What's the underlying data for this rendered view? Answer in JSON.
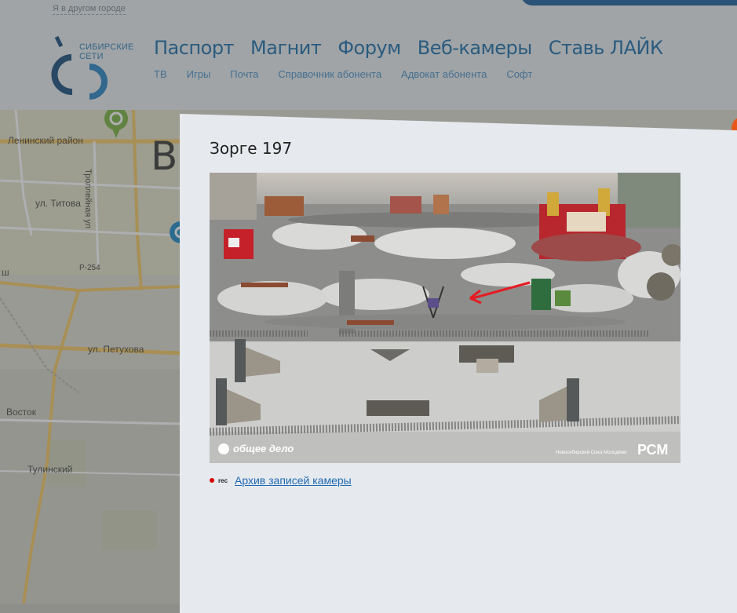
{
  "header": {
    "city_link": "Я в другом городе",
    "logo_text_line1": "Сибирские",
    "logo_text_line2": "сети",
    "main_nav": [
      "Паспорт",
      "Магнит",
      "Форум",
      "Веб-камеры",
      "Ставь ЛАЙК"
    ],
    "sub_nav": [
      "ТВ",
      "Игры",
      "Почта",
      "Справочник абонента",
      "Адвокат абонента",
      "Софт"
    ]
  },
  "map": {
    "labels": [
      "Ленинский район",
      "ул. Титова",
      "Троллейная ул",
      "Р-254",
      "ул. Петухова",
      "Восток",
      "Тулинский",
      "ш"
    ],
    "big_letters": "Ве"
  },
  "modal": {
    "title": "Зорге 197",
    "camera_watermark_left": "общее дело",
    "camera_watermark_right": "РСМ",
    "camera_small_text": "Новосибирский Союз Молодёжи",
    "rec_label": "rec",
    "archive_link": "Архив записей камеры"
  },
  "colors": {
    "nav_blue": "#1e6eab",
    "subnav_blue": "#4e91c8",
    "modal_bg": "#e6eaee",
    "link_blue": "#1f69b3",
    "rec_red": "#d40000"
  }
}
